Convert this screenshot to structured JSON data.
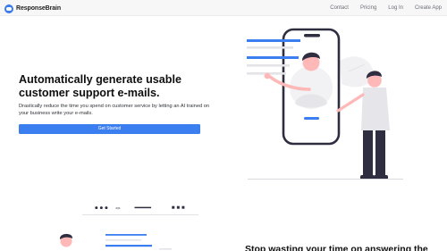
{
  "nav": {
    "brand": "ResponseBrain",
    "links": [
      "Contact",
      "Pricing",
      "Log In",
      "Create App"
    ]
  },
  "hero": {
    "title": "Automatically generate usable customer support e-mails.",
    "subtitle": "Drastically reduce the time you spend on customer service by letting an AI trained on your business write your e-mails.",
    "cta": "Get Started"
  },
  "mock_toolbar": {
    "code_icon_text": "<>"
  },
  "section2": {
    "title": "Stop wasting your time on answering the"
  },
  "colors": {
    "accent": "#3b7ef0",
    "dark": "#2f2e41",
    "nav_bg": "#f7f7f8"
  }
}
